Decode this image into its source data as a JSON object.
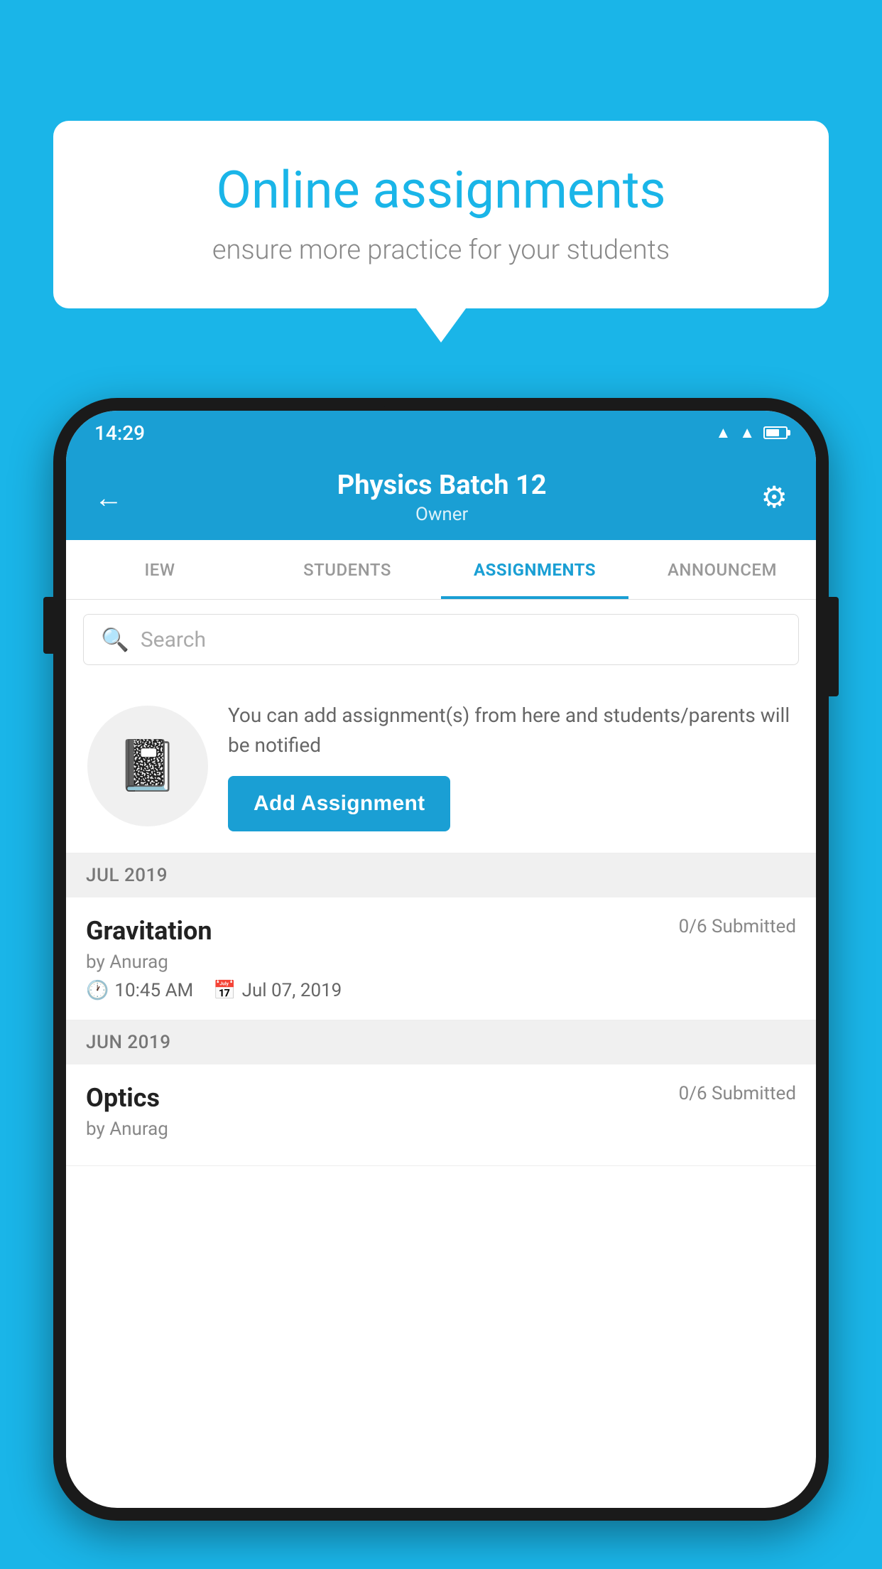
{
  "background_color": "#1ab5e8",
  "speech_bubble": {
    "title": "Online assignments",
    "subtitle": "ensure more practice for your students"
  },
  "status_bar": {
    "time": "14:29"
  },
  "header": {
    "title": "Physics Batch 12",
    "subtitle": "Owner",
    "back_label": "←",
    "gear_label": "⚙"
  },
  "tabs": [
    {
      "label": "IEW",
      "active": false
    },
    {
      "label": "STUDENTS",
      "active": false
    },
    {
      "label": "ASSIGNMENTS",
      "active": true
    },
    {
      "label": "ANNOUNCEM",
      "active": false
    }
  ],
  "search": {
    "placeholder": "Search"
  },
  "add_assignment_card": {
    "description": "You can add assignment(s) from here and students/parents will be notified",
    "button_label": "Add Assignment"
  },
  "sections": [
    {
      "label": "JUL 2019",
      "assignments": [
        {
          "name": "Gravitation",
          "submitted": "0/6 Submitted",
          "by": "by Anurag",
          "time": "10:45 AM",
          "date": "Jul 07, 2019"
        }
      ]
    },
    {
      "label": "JUN 2019",
      "assignments": [
        {
          "name": "Optics",
          "submitted": "0/6 Submitted",
          "by": "by Anurag",
          "time": "",
          "date": ""
        }
      ]
    }
  ]
}
